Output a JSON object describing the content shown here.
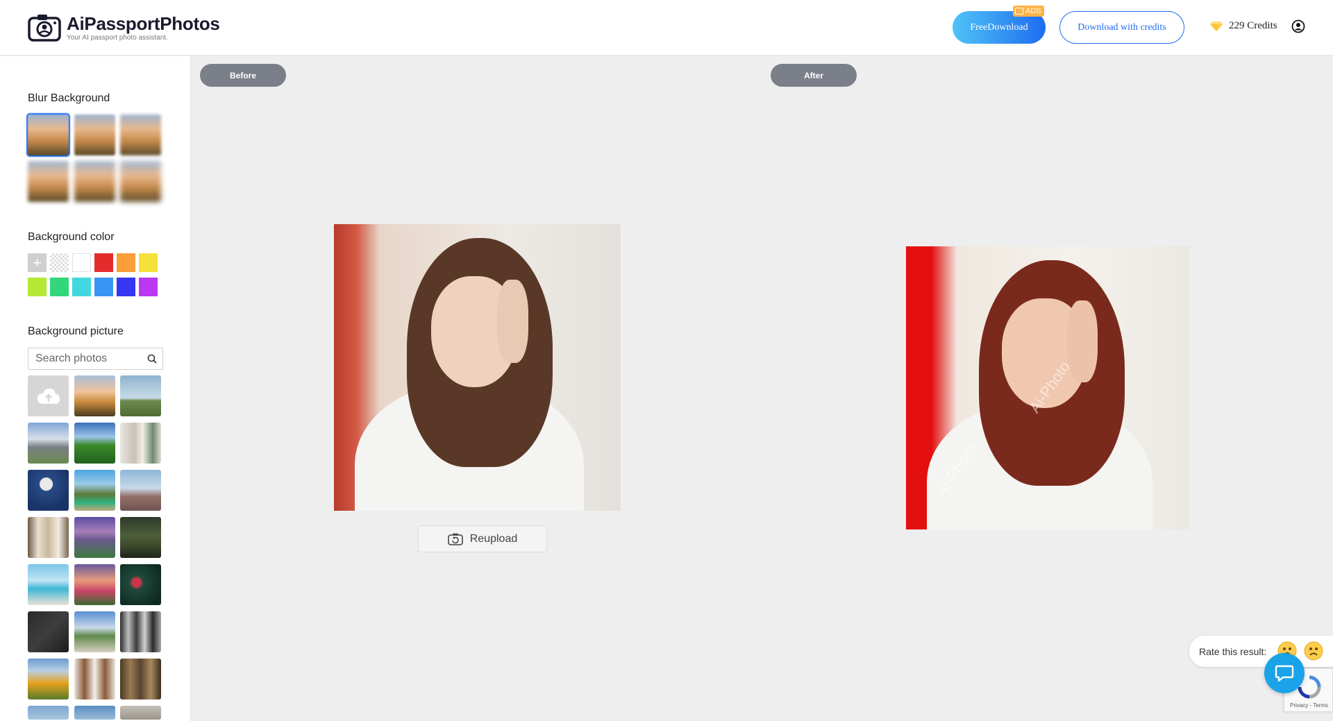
{
  "header": {
    "title": "AiPassportPhotos",
    "subtitle": "Your AI passport photo assistant.",
    "free_download_label": "FreeDownload",
    "ads_label": "ADS",
    "download_credits_label": "Download with credits",
    "credits_text": "229 Credits"
  },
  "sidebar": {
    "blur_title": "Blur Background",
    "color_title": "Background color",
    "picture_title": "Background picture",
    "search_placeholder": "Search photos",
    "plus_label": "+",
    "colors": [
      "#ffffff",
      "#e52c2c",
      "#fb9d38",
      "#f6e13a",
      "#b6e934",
      "#33d67a",
      "#40d8de",
      "#3995f4",
      "#3836f2",
      "#bb38f2"
    ]
  },
  "main": {
    "before_label": "Before",
    "after_label": "After",
    "reupload_label": "Reupload",
    "watermark_text": "Ai-Photo"
  },
  "feedback": {
    "rate_label": "Rate this result:"
  },
  "recaptcha": {
    "text": "Privacy - Terms"
  }
}
